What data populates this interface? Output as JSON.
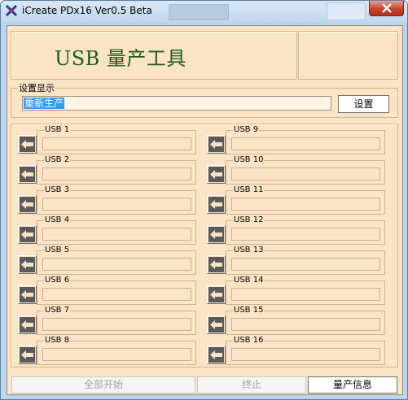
{
  "window": {
    "title": "iCreate PDx16 Ver0.5 Beta"
  },
  "header": {
    "app_title": "USB 量产工具"
  },
  "settings": {
    "legend": "设置显示",
    "value": "重新生产",
    "button_label": "设置"
  },
  "usb_ports": [
    {
      "label": "USB 1"
    },
    {
      "label": "USB 2"
    },
    {
      "label": "USB 3"
    },
    {
      "label": "USB 4"
    },
    {
      "label": "USB 5"
    },
    {
      "label": "USB 6"
    },
    {
      "label": "USB 7"
    },
    {
      "label": "USB 8"
    },
    {
      "label": "USB 9"
    },
    {
      "label": "USB 10"
    },
    {
      "label": "USB 11"
    },
    {
      "label": "USB 12"
    },
    {
      "label": "USB 13"
    },
    {
      "label": "USB 14"
    },
    {
      "label": "USB 15"
    },
    {
      "label": "USB 16"
    }
  ],
  "actions": {
    "start_all": "全部开始",
    "stop": "终止",
    "info": "量产信息"
  },
  "icons": {
    "app": "app-icon",
    "close": "close-icon",
    "port": "arrow-left-icon"
  },
  "colors": {
    "client_bg": "#fbe3c5",
    "title_color": "#1d5c1b",
    "frame": "#bcd5ee",
    "close": "#c7442b"
  }
}
